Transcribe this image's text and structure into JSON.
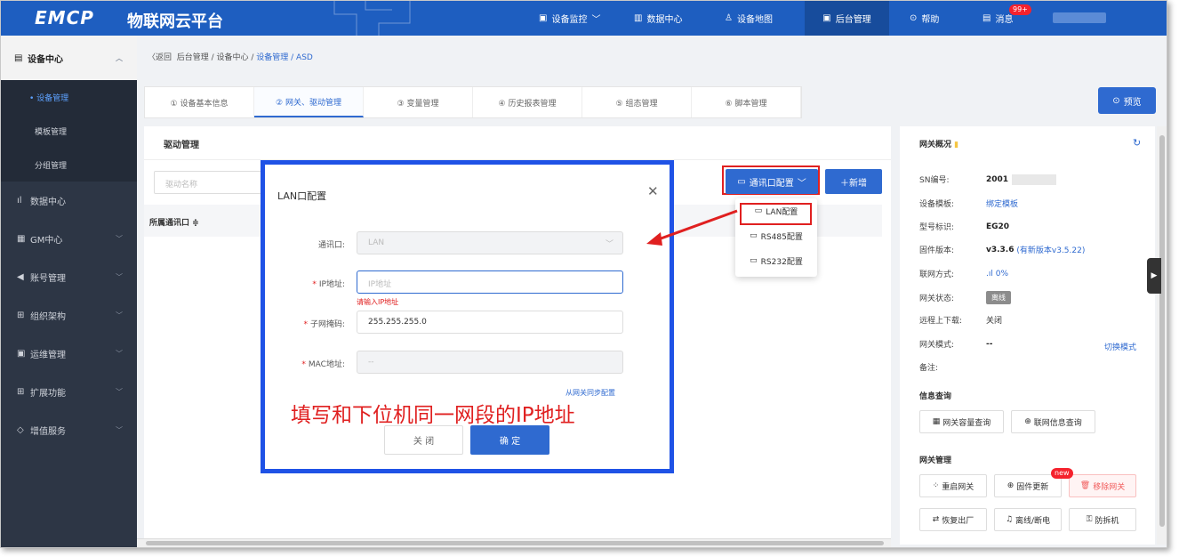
{
  "header": {
    "logo": "EMCP",
    "platform_name": "物联网云平台",
    "nav": [
      {
        "label": "设备监控",
        "icon": "monitor-icon"
      },
      {
        "label": "数据中心",
        "icon": "chart-icon"
      },
      {
        "label": "设备地图",
        "icon": "map-pin-icon"
      },
      {
        "label": "后台管理",
        "icon": "admin-icon"
      },
      {
        "label": "帮助",
        "icon": "help-icon"
      },
      {
        "label": "消息",
        "icon": "message-icon"
      }
    ],
    "message_badge": "99+"
  },
  "sidebar": {
    "top": "设备中心",
    "sub_items": [
      "• 设备管理",
      "模板管理",
      "分组管理"
    ],
    "items": [
      {
        "label": "数据中心",
        "icon": "bar-chart-icon"
      },
      {
        "label": "GM中心",
        "icon": "gm-icon"
      },
      {
        "label": "账号管理",
        "icon": "user-icon"
      },
      {
        "label": "组织架构",
        "icon": "org-icon"
      },
      {
        "label": "运维管理",
        "icon": "ops-icon"
      },
      {
        "label": "扩展功能",
        "icon": "grid-icon"
      },
      {
        "label": "增值服务",
        "icon": "diamond-icon"
      }
    ]
  },
  "breadcrumb": {
    "back": "〈返回",
    "path": "后台管理 / 设备中心 / ",
    "current": "设备管理",
    "leaf": " / ASD"
  },
  "tabs": [
    "① 设备基本信息",
    "② 网关、驱动管理",
    "③ 变量管理",
    "④ 历史报表管理",
    "⑤ 组态管理",
    "⑥ 脚本管理"
  ],
  "preview_button": "预览",
  "driver_panel": {
    "title": "驱动管理",
    "search_placeholder": "驱动名称",
    "column_header": "所属通讯口 ≑",
    "comm_button": "通讯口配置",
    "add_button": "＋新增",
    "dropdown": [
      "LAN配置",
      "RS485配置",
      "RS232配置"
    ]
  },
  "gateway": {
    "title": "网关概况",
    "rows": [
      {
        "label": "SN编号:",
        "value": "2001"
      },
      {
        "label": "设备模板:",
        "value": "绑定模板"
      },
      {
        "label": "型号标识:",
        "value": "EG20"
      },
      {
        "label": "固件版本:",
        "value": "v3.3.6",
        "extra": "(有新版本v3.5.22)"
      },
      {
        "label": "联网方式:",
        "value": "0%"
      },
      {
        "label": "网关状态:",
        "value": "离线"
      },
      {
        "label": "远程上下载:",
        "value": "关闭"
      },
      {
        "label": "网关模式:",
        "value": "--"
      },
      {
        "label": "备注:",
        "value": ""
      }
    ],
    "switch_mode": "切换模式",
    "info_section": "信息查询",
    "info_buttons": [
      "网关容量查询",
      "联网信息查询"
    ],
    "manage_section": "网关管理",
    "manage_buttons": [
      "重启网关",
      "固件更新",
      "移除网关",
      "恢复出厂",
      "离线/断电",
      "防拆机"
    ],
    "new_badge": "new"
  },
  "modal": {
    "title": "LAN口配置",
    "fields": [
      {
        "label": "通讯口:",
        "value": "LAN",
        "required": false
      },
      {
        "label": "IP地址:",
        "placeholder": "IP地址",
        "required": true,
        "error": "请输入IP地址"
      },
      {
        "label": "子网掩码:",
        "value": "255.255.255.0",
        "required": true
      },
      {
        "label": "MAC地址:",
        "value": "--",
        "required": true
      }
    ],
    "sync_link": "从网关同步配置",
    "cancel": "关 闭",
    "confirm": "确 定"
  },
  "annotation": "填写和下位机同一网段的IP地址",
  "colors": {
    "primary": "#2f6ad0",
    "header": "#1e5ec0",
    "annotation": "#e02020",
    "modal_border": "#1f52e6"
  }
}
